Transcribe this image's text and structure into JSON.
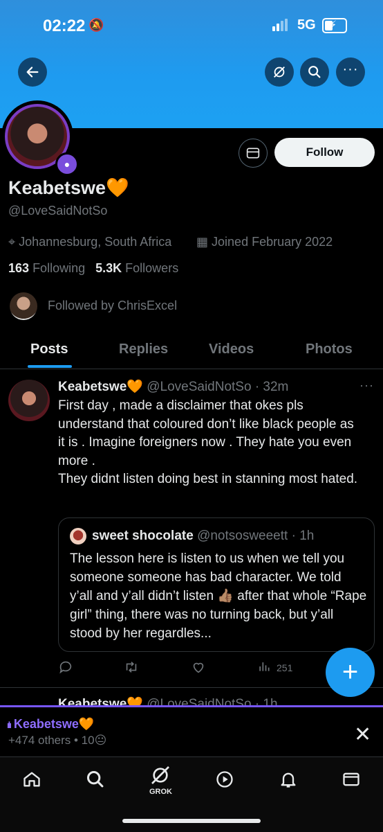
{
  "status_bar": {
    "time": "02:22",
    "network": "5G"
  },
  "profile": {
    "name": "Keabetswe🧡",
    "handle": "@LoveSaidNotSo",
    "location": "Johannesburg, South Africa",
    "joined": "Joined February 2022",
    "following_count": "163",
    "following_label": "Following",
    "followers_count": "5.3K",
    "followers_label": "Followers",
    "followed_by": "Followed by ChrisExcel",
    "follow_label": "Follow"
  },
  "tabs": [
    "Posts",
    "Replies",
    "Videos",
    "Photos"
  ],
  "post": {
    "author": "Keabetswe🧡",
    "handle_time": "@LoveSaidNotSo · 32m",
    "text_lines": [
      "First day , made a disclaimer that okes pls understand that  coloured don’t like black people as it is . Imagine foreigners now . They hate you even more .",
      "They didnt listen doing best in stanning most hated."
    ],
    "quote": {
      "author": "sweet shocolate",
      "handle_time": "@notsosweeett · 1h",
      "text": "The lesson here is listen to us when we tell you someone someone has bad character. We told y’all and y’all didn’t listen 👍🏽 after that whole “Rape girl” thing, there was no turning back, but y’all stood by her regardles..."
    },
    "views": "251"
  },
  "next_post": {
    "author": "Keabetswe🧡",
    "handle_time": "@LoveSaidNotSo · 1h"
  },
  "space": {
    "title": "Keabetswe🧡",
    "subtitle": "+474 others • 10😐"
  },
  "nav": {
    "grok_label": "GROK"
  },
  "colors": {
    "accent": "#1d9bf0",
    "space": "#7856ff"
  }
}
